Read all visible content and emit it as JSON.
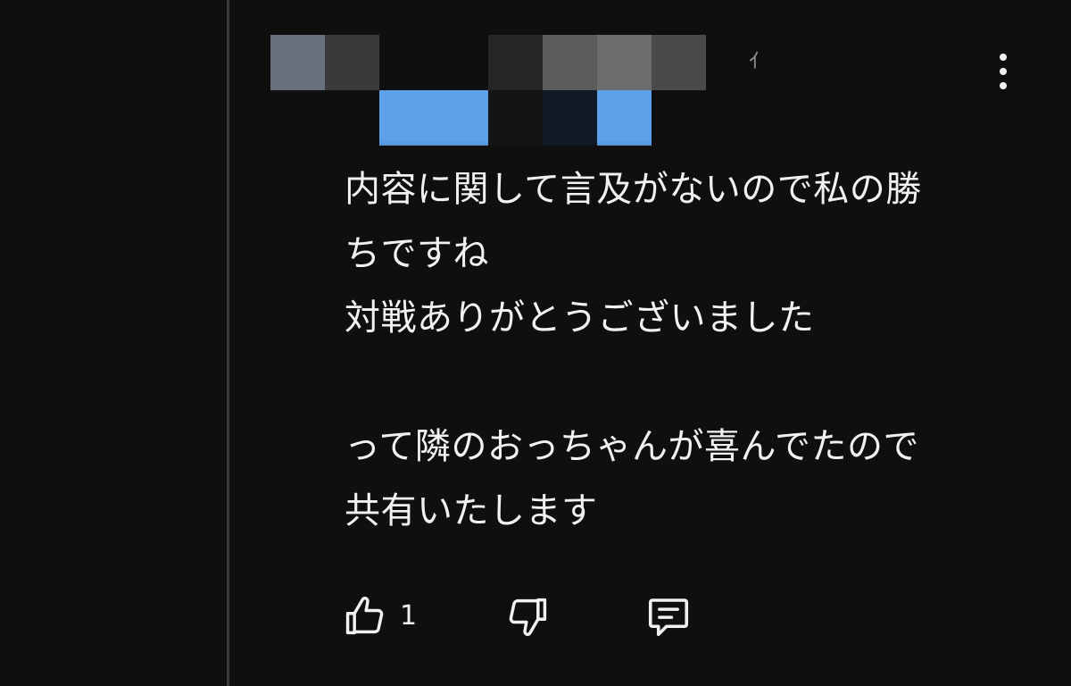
{
  "comment": {
    "body": "内容に関して言及がないので私の勝\nちですね\n対戦ありがとうございました\n\nって隣のおっちゃんが喜んでたので\n共有いたします",
    "partial_char": "ｨ"
  },
  "actions": {
    "like_count": "1",
    "like_icon": "thumbs-up-icon",
    "dislike_icon": "thumbs-down-icon",
    "reply_icon": "comment-icon",
    "more_icon": "more-vertical-icon"
  },
  "colors": {
    "background": "#0f0f0f",
    "text": "#f1f1f1",
    "thread_line": "#3a3a3a",
    "mention_blue": "#5ea1ea"
  }
}
